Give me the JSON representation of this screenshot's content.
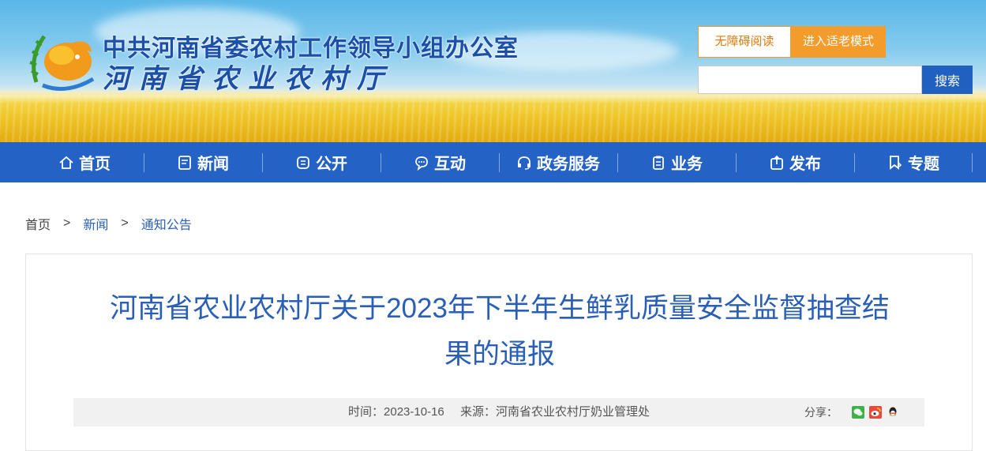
{
  "header": {
    "org_name": "中共河南省委农村工作领导小组办公室",
    "dept_name": "河南省农业农村厅",
    "accessibility_label": "无障碍阅读",
    "elder_mode_label": "进入适老模式",
    "search_value": "",
    "search_button": "搜索"
  },
  "nav": {
    "items": [
      {
        "label": "首页",
        "icon": "home-icon"
      },
      {
        "label": "新闻",
        "icon": "news-icon"
      },
      {
        "label": "公开",
        "icon": "open-icon"
      },
      {
        "label": "互动",
        "icon": "chat-icon"
      },
      {
        "label": "政务服务",
        "icon": "headset-icon"
      },
      {
        "label": "业务",
        "icon": "clipboard-icon"
      },
      {
        "label": "发布",
        "icon": "publish-icon"
      },
      {
        "label": "专题",
        "icon": "bookmark-icon"
      }
    ]
  },
  "breadcrumb": {
    "home": "首页",
    "sep": ">",
    "news": "新闻",
    "current": "通知公告"
  },
  "article": {
    "title_line1": "河南省农业农村厅关于2023年下半年生鲜乳质量安全监督抽查结",
    "title_line2": "果的通报",
    "time": "时间：2023-10-16",
    "source": "来源：河南省农业农村厅奶业管理处",
    "share_label": "分享：",
    "share_icons": [
      "wechat-icon",
      "weibo-icon",
      "qq-icon"
    ]
  },
  "colors": {
    "nav_bg": "#2462c6",
    "title_blue": "#2a5fb8",
    "accent_orange": "#f39b2b",
    "search_blue": "#2060c0"
  }
}
